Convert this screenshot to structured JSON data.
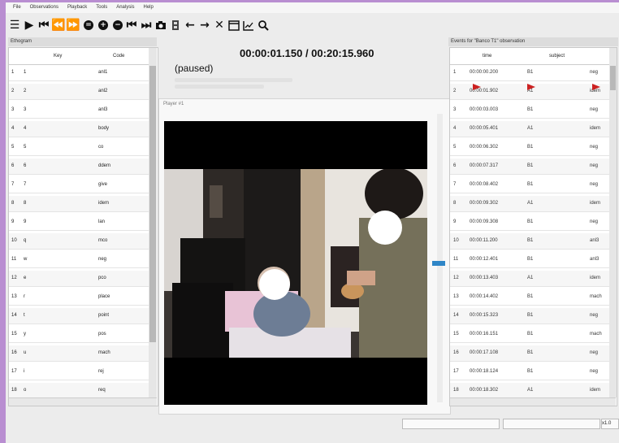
{
  "menu": [
    "File",
    "Observations",
    "Playback",
    "Tools",
    "Analysis",
    "Help"
  ],
  "toolbar": {
    "icons": [
      "menu-icon",
      "play-icon",
      "skip-start-icon",
      "rewind-icon",
      "forward-icon",
      "pause-circle-icon",
      "add-circle-icon",
      "remove-circle-icon",
      "skip-back-icon",
      "skip-forward-icon",
      "camera-icon",
      "film-icon",
      "arrow-left-icon",
      "arrow-right-icon",
      "close-icon",
      "window-icon",
      "chart-icon",
      "search-icon"
    ]
  },
  "ethogram": {
    "title": "Ethogram",
    "columns": [
      "Key",
      "Code"
    ],
    "rows": [
      {
        "n": "1",
        "key": "1",
        "code": "anl1"
      },
      {
        "n": "2",
        "key": "2",
        "code": "anl2"
      },
      {
        "n": "3",
        "key": "3",
        "code": "anl3"
      },
      {
        "n": "4",
        "key": "4",
        "code": "body"
      },
      {
        "n": "5",
        "key": "5",
        "code": "co"
      },
      {
        "n": "6",
        "key": "6",
        "code": "ddem"
      },
      {
        "n": "7",
        "key": "7",
        "code": "give"
      },
      {
        "n": "8",
        "key": "8",
        "code": "idem"
      },
      {
        "n": "9",
        "key": "9",
        "code": "lan"
      },
      {
        "n": "10",
        "key": "q",
        "code": "mco"
      },
      {
        "n": "11",
        "key": "w",
        "code": "neg"
      },
      {
        "n": "12",
        "key": "e",
        "code": "pco"
      },
      {
        "n": "13",
        "key": "r",
        "code": "place"
      },
      {
        "n": "14",
        "key": "t",
        "code": "point"
      },
      {
        "n": "15",
        "key": "y",
        "code": "pos"
      },
      {
        "n": "16",
        "key": "u",
        "code": "mach"
      },
      {
        "n": "17",
        "key": "i",
        "code": "rej"
      },
      {
        "n": "18",
        "key": "o",
        "code": "req"
      }
    ]
  },
  "player": {
    "time": "00:00:01.150 / 00:20:15.960",
    "status": "(paused)",
    "title": "Player #1"
  },
  "events": {
    "title": "Events for \"Banco T1\" observation",
    "columns": [
      "time",
      "subject",
      ""
    ],
    "rows": [
      {
        "n": "1",
        "time": "00:00:00.200",
        "subject": "B1",
        "code": "neg"
      },
      {
        "n": "2",
        "time": "00:00:01.902",
        "subject": "A1",
        "code": "idem"
      },
      {
        "n": "3",
        "time": "00:00:03.003",
        "subject": "B1",
        "code": "neg"
      },
      {
        "n": "4",
        "time": "00:00:05.401",
        "subject": "A1",
        "code": "idem"
      },
      {
        "n": "5",
        "time": "00:00:06.302",
        "subject": "B1",
        "code": "neg"
      },
      {
        "n": "6",
        "time": "00:00:07.317",
        "subject": "B1",
        "code": "neg"
      },
      {
        "n": "7",
        "time": "00:00:08.402",
        "subject": "B1",
        "code": "neg"
      },
      {
        "n": "8",
        "time": "00:00:09.302",
        "subject": "A1",
        "code": "idem"
      },
      {
        "n": "9",
        "time": "00:00:09.308",
        "subject": "B1",
        "code": "neg"
      },
      {
        "n": "10",
        "time": "00:00:11.200",
        "subject": "B1",
        "code": "anl3"
      },
      {
        "n": "11",
        "time": "00:00:12.401",
        "subject": "B1",
        "code": "anl3"
      },
      {
        "n": "12",
        "time": "00:00:13.403",
        "subject": "A1",
        "code": "idem"
      },
      {
        "n": "13",
        "time": "00:00:14.402",
        "subject": "B1",
        "code": "mach"
      },
      {
        "n": "14",
        "time": "00:00:15.323",
        "subject": "B1",
        "code": "neg"
      },
      {
        "n": "15",
        "time": "00:00:16.151",
        "subject": "B1",
        "code": "mach"
      },
      {
        "n": "16",
        "time": "00:00:17.108",
        "subject": "B1",
        "code": "neg"
      },
      {
        "n": "17",
        "time": "00:00:18.124",
        "subject": "B1",
        "code": "neg"
      },
      {
        "n": "18",
        "time": "00:00:18.302",
        "subject": "A1",
        "code": "idem"
      }
    ]
  },
  "statusbar": {
    "zoom": "x1.0"
  },
  "colors": {
    "accent": "#2f86c7",
    "flag": "#c22222",
    "frame": "#b98ed1"
  }
}
